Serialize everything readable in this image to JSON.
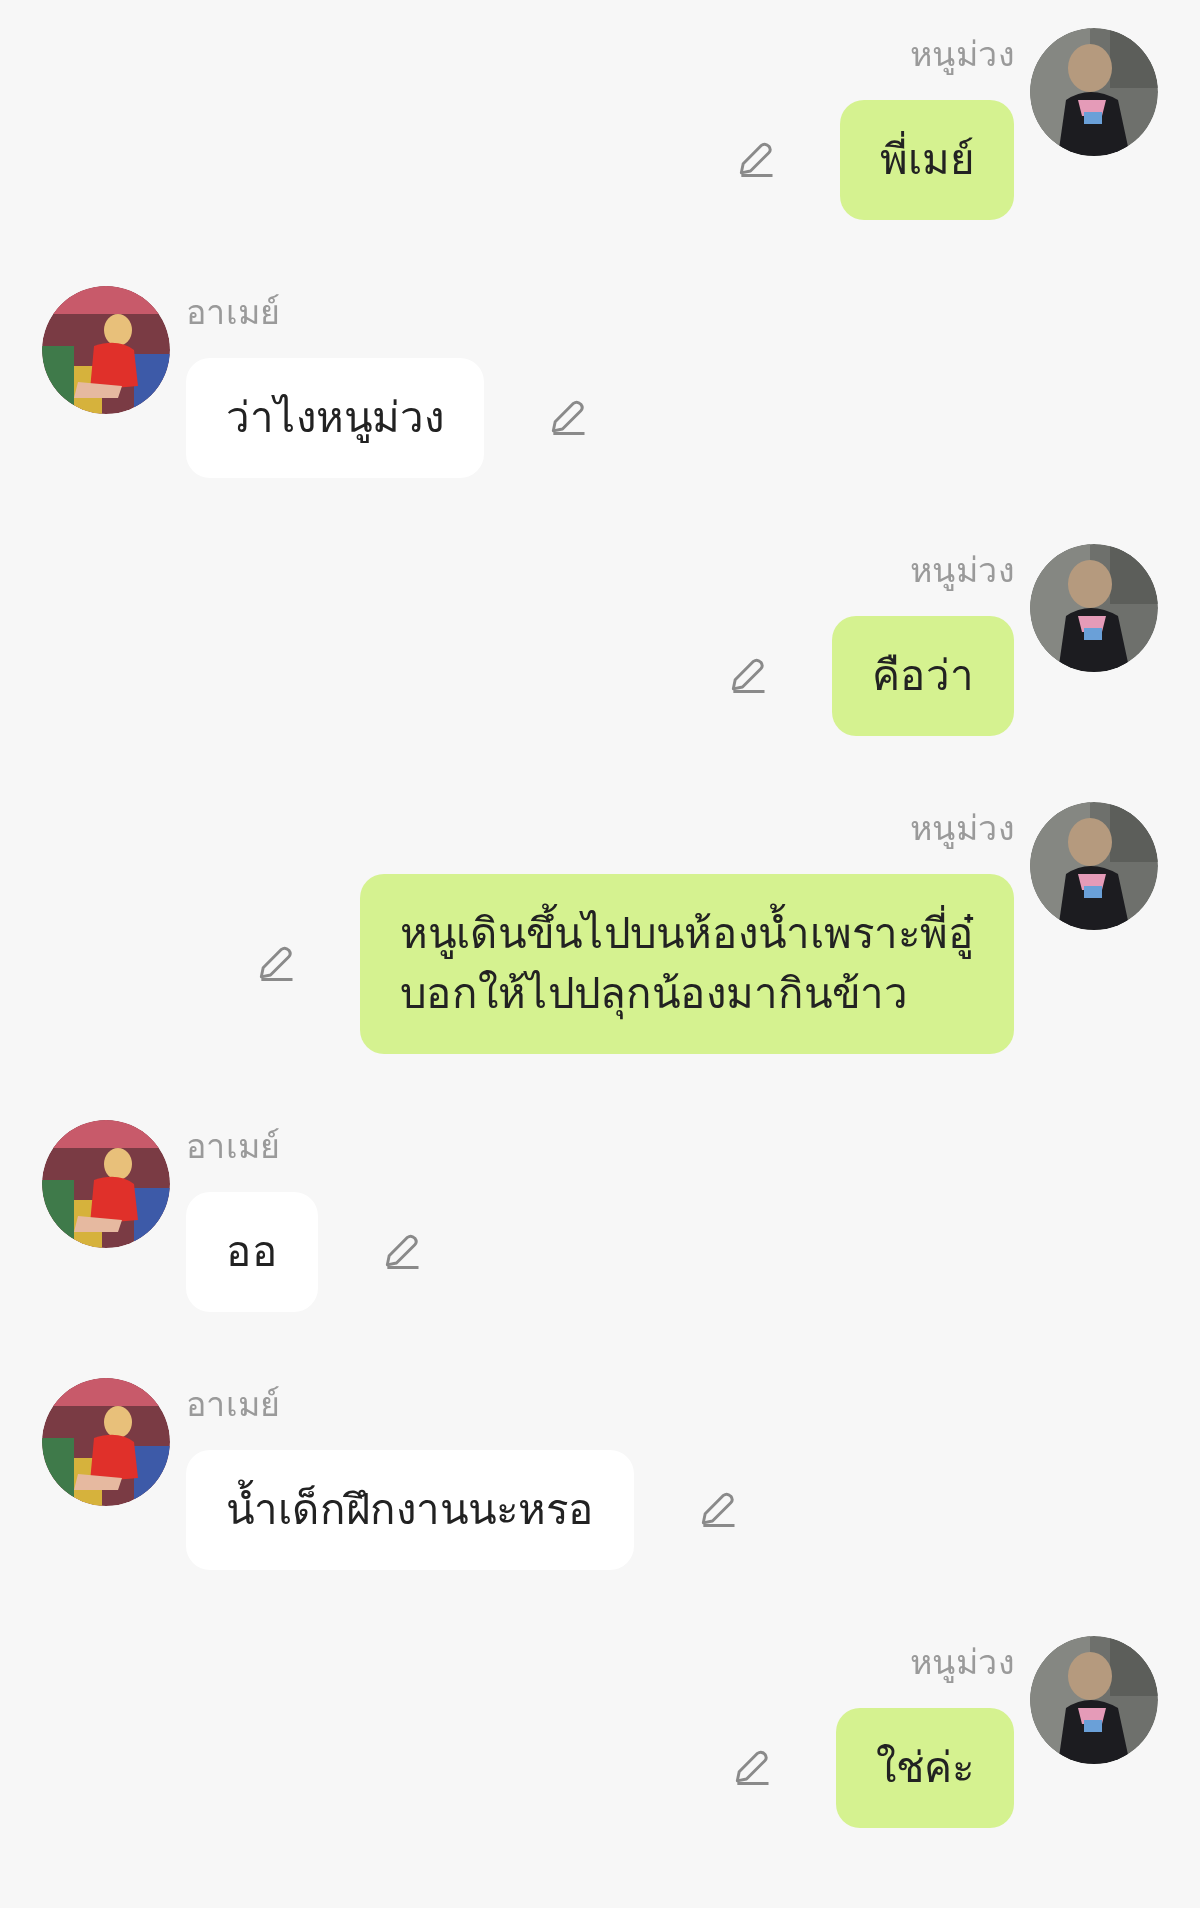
{
  "messages": [
    {
      "kind": "outgoing",
      "sender": "หนูม่วง",
      "text": "พี่เมย์"
    },
    {
      "kind": "incoming",
      "sender": "อาเมย์",
      "text": "ว่าไงหนูม่วง"
    },
    {
      "kind": "outgoing",
      "sender": "หนูม่วง",
      "text": "คือว่า"
    },
    {
      "kind": "outgoing",
      "sender": "หนูม่วง",
      "text": "หนูเดินขึ้นไปบนห้องน้ำเพราะพี่อู๋\nบอกให้ไปปลุกน้องมากินข้าว"
    },
    {
      "kind": "incoming",
      "sender": "อาเมย์",
      "text": "ออ"
    },
    {
      "kind": "incoming",
      "sender": "อาเมย์",
      "text": "น้ำเด็กฝึกงานนะหรอ"
    },
    {
      "kind": "outgoing",
      "sender": "หนูม่วง",
      "text": "ใช่ค่ะ"
    }
  ]
}
